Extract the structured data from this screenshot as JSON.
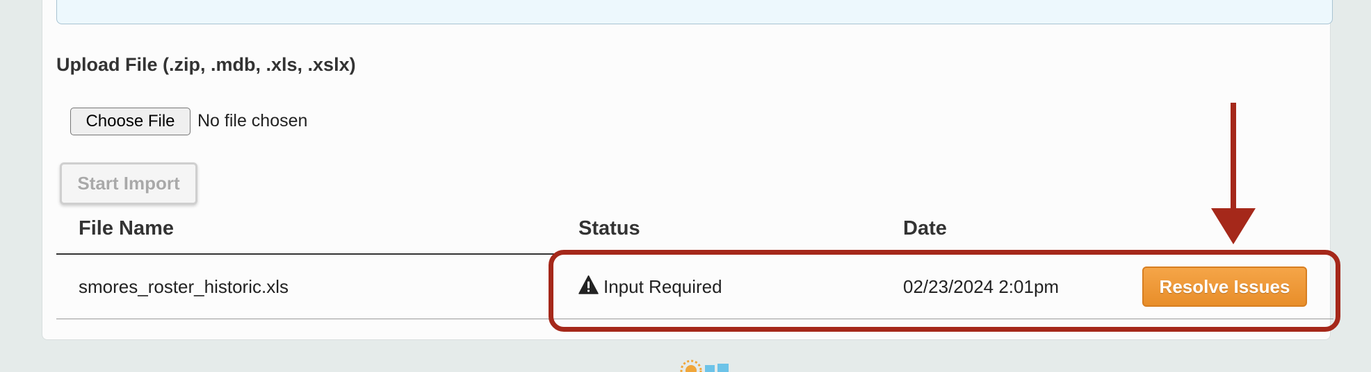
{
  "upload": {
    "heading": "Upload File (.zip, .mdb, .xls, .xslx)",
    "choose_file_label": "Choose File",
    "no_file_text": "No file chosen",
    "start_import_label": "Start Import"
  },
  "table": {
    "columns": [
      "File Name",
      "Status",
      "Date"
    ],
    "rows": [
      {
        "file_name": "smores_roster_historic.xls",
        "status": "Input Required",
        "status_icon": "warning-icon",
        "date": "02/23/2024 2:01pm",
        "action_label": "Resolve Issues"
      }
    ]
  },
  "colors": {
    "annotation": "#a5281a",
    "action_button": "#ef9a3a",
    "info_box_bg": "#edf8fd"
  }
}
